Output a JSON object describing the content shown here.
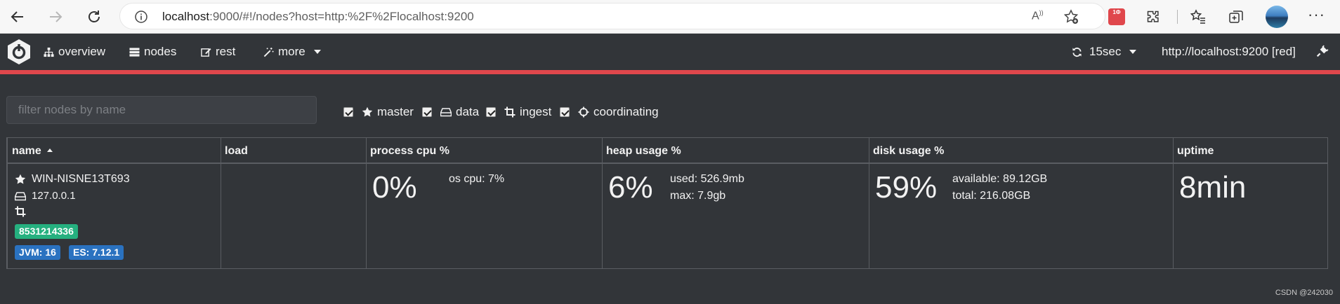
{
  "browser": {
    "url_host": "localhost",
    "url_rest": ":9000/#!/nodes?host=http:%2F%2Flocalhost:9200",
    "read_aloud": "A",
    "ext_badge": "1Ф"
  },
  "nav": {
    "overview": "overview",
    "nodes": "nodes",
    "rest": "rest",
    "more": "more",
    "refresh": "15sec",
    "cluster": "http://localhost:9200 [red]"
  },
  "filter": {
    "placeholder": "filter nodes by name",
    "master": "master",
    "data": "data",
    "ingest": "ingest",
    "coordinating": "coordinating"
  },
  "table": {
    "headers": {
      "name": "name",
      "load": "load",
      "cpu": "process cpu %",
      "heap": "heap usage %",
      "disk": "disk usage %",
      "uptime": "uptime"
    },
    "node": {
      "name": "WIN-NISNE13T693",
      "ip": "127.0.0.1",
      "id_badge": "8531214336",
      "jvm_badge": "JVM: 16",
      "es_badge": "ES: 7.12.1",
      "load": "",
      "cpu_pct": "0%",
      "os_cpu": "os cpu: 7%",
      "heap_pct": "6%",
      "heap_used": "used: 526.9mb",
      "heap_max": "max: 7.9gb",
      "disk_pct": "59%",
      "disk_available": "available: 89.12GB",
      "disk_total": "total: 216.08GB",
      "uptime": "8min"
    }
  },
  "footer": {
    "watermark": "CSDN @242030"
  },
  "colors": {
    "background": "#323539",
    "accent_red": "#e0474c",
    "badge_green": "#25b07f",
    "badge_blue": "#2a72c0"
  }
}
